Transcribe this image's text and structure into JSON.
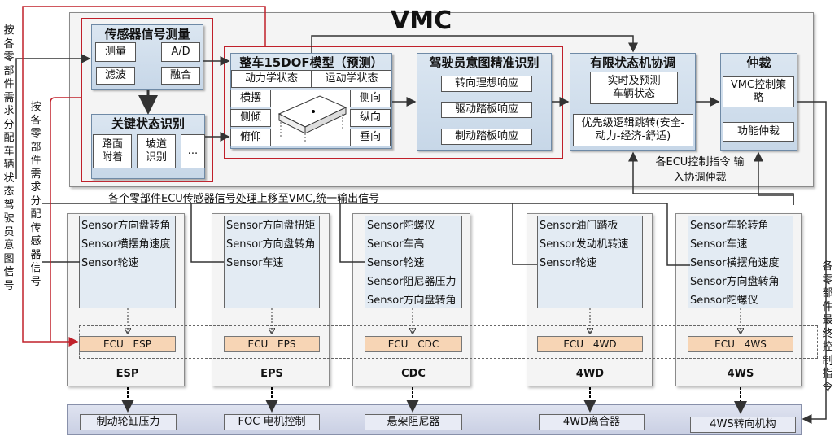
{
  "vmc_title": "VMC",
  "left_label_outer": "按各零部件需求分配车辆状态驾驶员意图信号",
  "left_label_inner": "按各零部件需求分配传感器信号",
  "right_label": "各零部件最终控制指令",
  "sensor_measure": {
    "title": "传感器信号测量",
    "items": [
      "测量",
      "A/D",
      "滤波",
      "融合"
    ]
  },
  "key_state": {
    "title": "关键状态识别",
    "items": [
      "路面附着",
      "坡道识别",
      "..."
    ]
  },
  "dof_model": {
    "title": "整车15DOF模型（预测）",
    "states": [
      "动力学状态",
      "运动学状态"
    ],
    "left": [
      "横摆",
      "侧倾",
      "俯仰"
    ],
    "right": [
      "侧向",
      "纵向",
      "垂向"
    ]
  },
  "driver_intent": {
    "title": "驾驶员意图精准识别",
    "items": [
      "转向理想响应",
      "驱动踏板响应",
      "制动踏板响应"
    ]
  },
  "fsm": {
    "title": "有限状态机协调",
    "items": [
      "实时及预测车辆状态",
      "优先级逻辑跳转(安全-动力-经济-舒适)"
    ]
  },
  "arbitration": {
    "title": "仲裁",
    "items": [
      "VMC控制策略",
      "功能仲裁"
    ]
  },
  "ecu_cmd_note": "各ECU控制指令 输入协调仲裁",
  "upshift_note": "各个零部件ECU传感器信号处理上移至VMC,统一输出信号",
  "ecus": [
    {
      "name": "ESP",
      "ecu": "ECU ESP",
      "sensors": [
        "Sensor方向盘转角",
        "Sensor横摆角速度",
        "Sensor轮速"
      ],
      "actuator": "制动轮缸压力"
    },
    {
      "name": "EPS",
      "ecu": "ECU EPS",
      "sensors": [
        "Sensor方向盘扭矩",
        "Sensor方向盘转角",
        "Sensor车速"
      ],
      "actuator": "FOC 电机控制"
    },
    {
      "name": "CDC",
      "ecu": "ECU CDC",
      "sensors": [
        "Sensor陀螺仪",
        "Sensor车高",
        "Sensor轮速",
        "Sensor阻尼器压力",
        "Sensor方向盘转角"
      ],
      "actuator": "悬架阻尼器"
    },
    {
      "name": "4WD",
      "ecu": "ECU 4WD",
      "sensors": [
        "Sensor油门踏板",
        "Sensor发动机转速",
        "Sensor轮速"
      ],
      "actuator": "4WD离合器"
    },
    {
      "name": "4WS",
      "ecu": "ECU 4WS",
      "sensors": [
        "Sensor车轮转角",
        "Sensor车速",
        "Sensor横摆角速度",
        "Sensor方向盘转角",
        "Sensor陀螺仪"
      ],
      "actuator": "4WS转向机构"
    }
  ],
  "colors": {
    "red_outline": "#c0202a",
    "block_blue": "#c7d7e8",
    "ecu_orange": "#f7d5b5"
  }
}
